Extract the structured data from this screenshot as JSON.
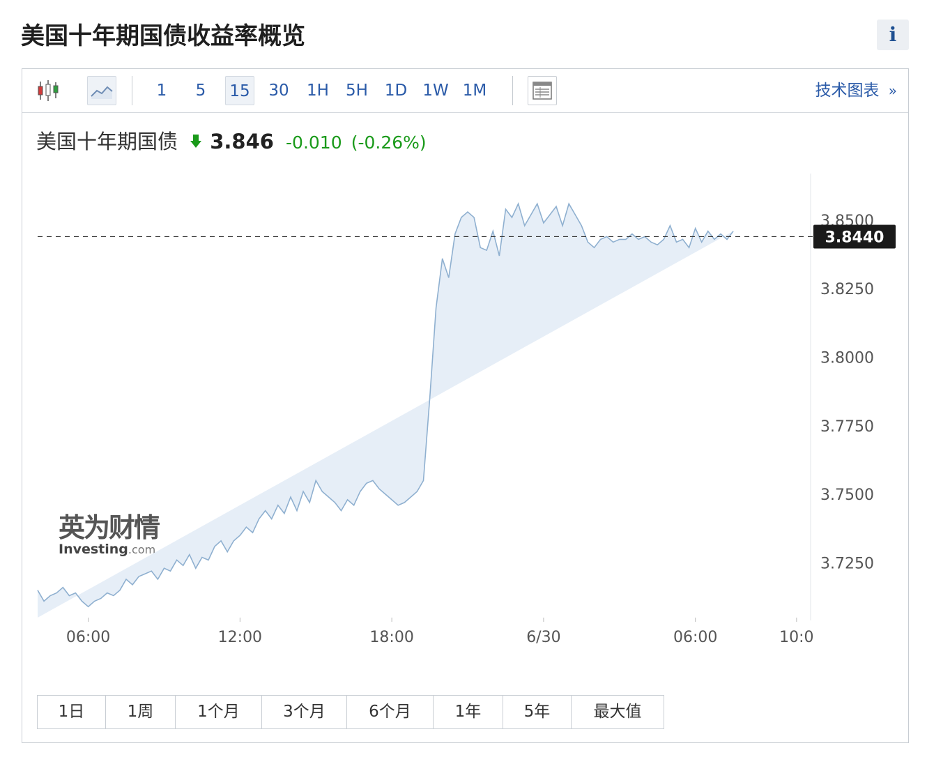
{
  "page": {
    "title": "美国十年期国债收益率概览",
    "info_label": "i"
  },
  "toolbar": {
    "intervals": [
      "1",
      "5",
      "15",
      "30",
      "1H",
      "5H",
      "1D",
      "1W",
      "1M"
    ],
    "active_interval": "15",
    "tech_chart_label": "技术图表",
    "tech_chart_arrow": "»"
  },
  "quote": {
    "name": "美国十年期国债",
    "price": "3.846",
    "change": "-0.010",
    "change_pct": "(-0.26%)",
    "direction": "down",
    "down_color": "#1a9a1a"
  },
  "watermark": {
    "cn": "英为财情",
    "en": "Investing",
    "en_suffix": ".com"
  },
  "range_buttons": [
    "1日",
    "1周",
    "1个月",
    "3个月",
    "6个月",
    "1年",
    "5年",
    "最大值"
  ],
  "chart_data": {
    "type": "area",
    "current_value_label": "3.8440",
    "current_value": 3.844,
    "y_ticks": [
      "3.8500",
      "3.8250",
      "3.8000",
      "3.7750",
      "3.7500",
      "3.7250"
    ],
    "ylim": [
      3.705,
      3.867
    ],
    "x_ticks": [
      {
        "label": "06:00",
        "x": 14
      },
      {
        "label": "12:00",
        "x": 38
      },
      {
        "label": "18:00",
        "x": 62
      },
      {
        "label": "6/30",
        "x": 86
      },
      {
        "label": "06:00",
        "x": 110
      },
      {
        "label": "10:0",
        "x": 126
      }
    ],
    "xlim": [
      6,
      128
    ],
    "line_color": "#8fb0d0",
    "fill_color": "#e6eef7",
    "x": [
      6,
      7,
      8,
      9,
      10,
      11,
      12,
      13,
      14,
      15,
      16,
      17,
      18,
      19,
      20,
      21,
      22,
      23,
      24,
      25,
      26,
      27,
      28,
      29,
      30,
      31,
      32,
      33,
      34,
      35,
      36,
      37,
      38,
      39,
      40,
      41,
      42,
      43,
      44,
      45,
      46,
      47,
      48,
      49,
      50,
      51,
      52,
      53,
      54,
      55,
      56,
      57,
      58,
      59,
      60,
      61,
      62,
      63,
      64,
      65,
      66,
      67,
      68,
      69,
      70,
      71,
      72,
      73,
      74,
      75,
      76,
      77,
      78,
      79,
      80,
      81,
      82,
      83,
      84,
      85,
      86,
      87,
      88,
      89,
      90,
      91,
      92,
      93,
      94,
      95,
      96,
      97,
      98,
      99,
      100,
      101,
      102,
      103,
      104,
      105,
      106,
      107,
      108,
      109,
      110,
      111,
      112,
      113,
      114,
      115,
      116,
      117,
      118,
      119,
      120,
      121,
      122,
      123,
      124,
      125,
      126
    ],
    "values": [
      3.715,
      3.711,
      3.713,
      3.714,
      3.716,
      3.713,
      3.714,
      3.711,
      3.709,
      3.711,
      3.712,
      3.714,
      3.713,
      3.715,
      3.719,
      3.717,
      3.72,
      3.721,
      3.722,
      3.719,
      3.723,
      3.722,
      3.726,
      3.724,
      3.728,
      3.723,
      3.727,
      3.726,
      3.731,
      3.733,
      3.729,
      3.733,
      3.735,
      3.738,
      3.736,
      3.741,
      3.744,
      3.741,
      3.746,
      3.743,
      3.749,
      3.744,
      3.751,
      3.747,
      3.755,
      3.751,
      3.749,
      3.747,
      3.744,
      3.748,
      3.746,
      3.751,
      3.754,
      3.755,
      3.752,
      3.75,
      3.748,
      3.746,
      3.747,
      3.749,
      3.751,
      3.755,
      3.785,
      3.818,
      3.836,
      3.829,
      3.845,
      3.851,
      3.853,
      3.851,
      3.84,
      3.839,
      3.846,
      3.837,
      3.854,
      3.851,
      3.856,
      3.848,
      3.852,
      3.856,
      3.849,
      3.852,
      3.855,
      3.848,
      3.856,
      3.852,
      3.848,
      3.842,
      3.84,
      3.843,
      3.844,
      3.842,
      3.843,
      3.843,
      3.845,
      3.843,
      3.844,
      3.842,
      3.841,
      3.843,
      3.848,
      3.842,
      3.843,
      3.84,
      3.847,
      3.842,
      3.846,
      3.843,
      3.845,
      3.843,
      3.846
    ]
  }
}
